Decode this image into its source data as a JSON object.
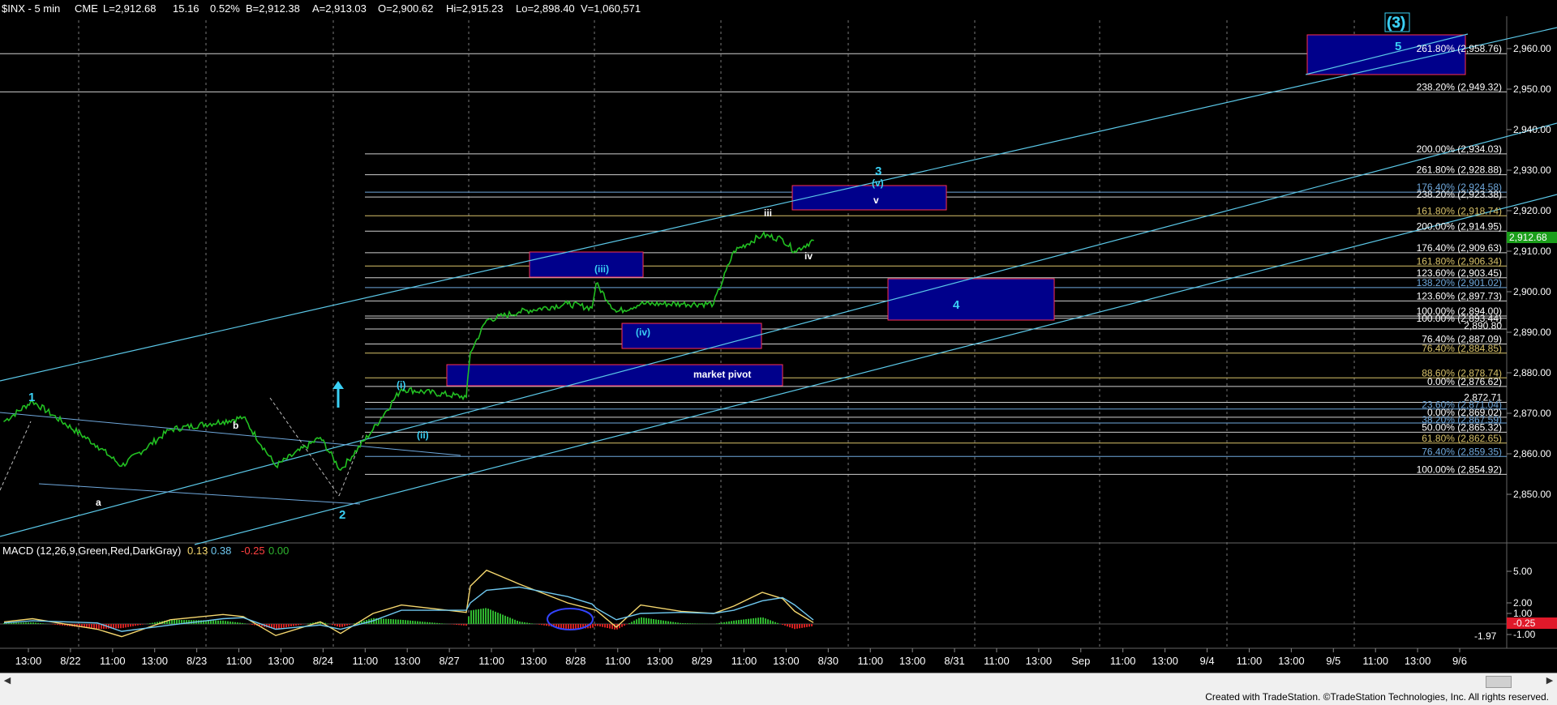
{
  "header": {
    "symbol": "$INX - 5 min",
    "exchange": "CME",
    "last": "L=2,912.68",
    "change": "15.16",
    "change_pct": "0.52%",
    "bid": "B=2,912.38",
    "ask": "A=2,913.03",
    "open": "O=2,900.62",
    "high": "Hi=2,915.23",
    "low": "Lo=2,898.40",
    "volume": "V=1,060,571"
  },
  "macd_header": {
    "title": "MACD (12,26,9,Green,Red,DarkGray)",
    "macd": "0.13",
    "signal": "0.38",
    "hist": "-0.25",
    "zero": "0.00"
  },
  "price_axis": {
    "ticks": [
      "2,960.00",
      "2,950.00",
      "2,940.00",
      "2,930.00",
      "2,920.00",
      "2,910.00",
      "2,900.00",
      "2,890.00",
      "2,880.00",
      "2,870.00",
      "2,860.00",
      "2,850.00"
    ],
    "last_price": "2,912.68"
  },
  "macd_axis": {
    "ticks": [
      "5.00",
      "2.00",
      "1.00",
      "-1.00"
    ],
    "low_marker": "-1.97",
    "current_marker": "-0.25"
  },
  "x_axis": {
    "labels": [
      "13:00",
      "8/22",
      "11:00",
      "13:00",
      "8/23",
      "11:00",
      "13:00",
      "8/24",
      "11:00",
      "13:00",
      "8/27",
      "11:00",
      "13:00",
      "8/28",
      "11:00",
      "13:00",
      "8/29",
      "11:00",
      "13:00",
      "8/30",
      "11:00",
      "13:00",
      "8/31",
      "11:00",
      "13:00",
      "Sep",
      "11:00",
      "13:00",
      "9/4",
      "11:00",
      "13:00",
      "9/5",
      "11:00",
      "13:00",
      "9/6"
    ]
  },
  "fib_labels": [
    {
      "text": "261.80% (2,958.76)",
      "color": "#ffffff"
    },
    {
      "text": "238.20% (2,949.32)",
      "color": "#ffffff"
    },
    {
      "text": "200.00% (2,934.03)",
      "color": "#ffffff"
    },
    {
      "text": "261.80% (2,928.88)",
      "color": "#ffffff"
    },
    {
      "text": "176.40% (2,924.58)",
      "color": "#6fa8dc"
    },
    {
      "text": "238.20% (2,923.38)",
      "color": "#ffffff"
    },
    {
      "text": "161.80% (2,918.74)",
      "color": "#d9c36a"
    },
    {
      "text": "200.00% (2,914.95)",
      "color": "#ffffff"
    },
    {
      "text": "176.40% (2,909.63)",
      "color": "#ffffff"
    },
    {
      "text": "161.80% (2,906.34)",
      "color": "#d9c36a"
    },
    {
      "text": "123.60% (2,903.45)",
      "color": "#ffffff"
    },
    {
      "text": "138.20% (2,901.02)",
      "color": "#6fa8dc"
    },
    {
      "text": "123.60% (2,897.73)",
      "color": "#ffffff"
    },
    {
      "text": "100.00% (2,894.00)",
      "color": "#ffffff"
    },
    {
      "text": "100.00% (2,893.44)",
      "color": "#ffffff"
    },
    {
      "text": "2,890.80",
      "color": "#ffffff"
    },
    {
      "text": "76.40% (2,887.09)",
      "color": "#ffffff"
    },
    {
      "text": "76.40% (2,884.85)",
      "color": "#d9c36a"
    },
    {
      "text": "88.60% (2,878.74)",
      "color": "#d9c36a"
    },
    {
      "text": "0.00% (2,876.62)",
      "color": "#ffffff"
    },
    {
      "text": "2,872.71",
      "color": "#ffffff"
    },
    {
      "text": "23.60% (2,871.04)",
      "color": "#6fa8dc"
    },
    {
      "text": "0.00% (2,869.02)",
      "color": "#ffffff"
    },
    {
      "text": "38.20% (2,867.59)",
      "color": "#6fa8dc"
    },
    {
      "text": "50.00% (2,865.32)",
      "color": "#ffffff"
    },
    {
      "text": "61.80% (2,862.65)",
      "color": "#d9c36a"
    },
    {
      "text": "76.40% (2,859.35)",
      "color": "#6fa8dc"
    },
    {
      "text": "100.00% (2,854.92)",
      "color": "#ffffff"
    }
  ],
  "wave_labels": {
    "w1": "1",
    "w2": "2",
    "w3": "3",
    "w4": "4",
    "w5": "5",
    "w_big3": "(3)",
    "wa": "a",
    "wb": "b",
    "wi": "(i)",
    "wii": "(ii)",
    "wiii": "(iii)",
    "wiv": "(iv)",
    "wv": "(v)",
    "siii": "iii",
    "siv": "iv",
    "sv": "v",
    "pivot": "market pivot"
  },
  "chart_data": {
    "type": "line",
    "title": "$INX - 5 min",
    "ylim": [
      2845,
      2965
    ],
    "x": [
      "8/21 13:00",
      "8/22 09:30",
      "8/22 11:00",
      "8/22 13:00",
      "8/22 15:00",
      "8/23 09:30",
      "8/23 11:00",
      "8/23 13:00",
      "8/23 15:00",
      "8/24 09:30",
      "8/24 11:00",
      "8/24 13:00",
      "8/24 15:30",
      "8/27 09:30",
      "8/27 10:00",
      "8/27 11:00",
      "8/27 13:00",
      "8/27 15:00",
      "8/28 09:30",
      "8/28 10:00",
      "8/28 11:00",
      "8/28 13:00",
      "8/28 15:00",
      "8/29 09:30",
      "8/29 11:00",
      "8/29 12:00",
      "8/29 13:00",
      "8/29 14:00"
    ],
    "series": [
      {
        "values": [
          2868,
          2873,
          2862,
          2857,
          2866,
          2868,
          2869,
          2857,
          2864,
          2856,
          2866,
          2876,
          2874,
          2885,
          2893,
          2895,
          2897,
          2896,
          2902,
          2895,
          2897,
          2897,
          2897,
          2910,
          2914,
          2913,
          2910,
          2912.68
        ]
      }
    ],
    "macd_series": [
      {
        "name": "MACD",
        "values": [
          0.2,
          0.5,
          -0.5,
          -1.2,
          0.4,
          0.9,
          0.7,
          -1.1,
          0.2,
          -0.9,
          1.0,
          1.8,
          1.1,
          3.6,
          5.1,
          3.8,
          2.0,
          1.4,
          1.3,
          -0.3,
          1.8,
          1.2,
          1.0,
          1.7,
          3.0,
          2.4,
          1.2,
          0.13
        ]
      },
      {
        "name": "Signal",
        "values": [
          0.1,
          0.3,
          0.1,
          -0.7,
          -0.1,
          0.5,
          0.6,
          -0.5,
          -0.1,
          -0.5,
          0.3,
          1.3,
          1.3,
          2.0,
          3.2,
          3.5,
          2.6,
          1.9,
          1.5,
          0.4,
          1.0,
          1.1,
          1.0,
          1.3,
          2.2,
          2.5,
          1.8,
          0.38
        ]
      }
    ]
  },
  "footer": {
    "credit": "Created with TradeStation. ©TradeStation Technologies, Inc. All rights reserved."
  }
}
